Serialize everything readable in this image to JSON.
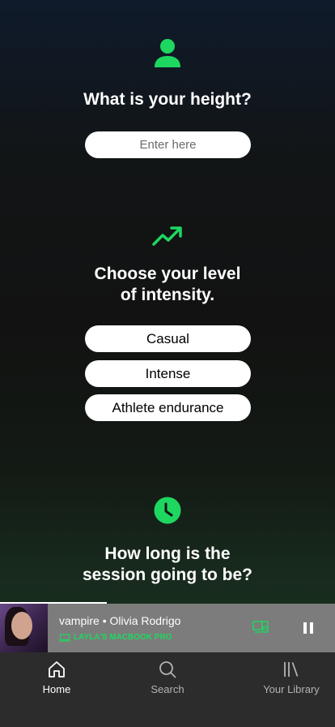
{
  "height_section": {
    "question": "What is your height?",
    "input_placeholder": "Enter here"
  },
  "intensity_section": {
    "question_line1": "Choose your level",
    "question_line2": "of intensity.",
    "options": [
      "Casual",
      "Intense",
      "Athlete endurance"
    ]
  },
  "session_section": {
    "question_line1": "How long is the",
    "question_line2": "session going to be?"
  },
  "player": {
    "song": "vampire",
    "separator": "•",
    "artist": "Olivia Rodrigo",
    "device": "LAYLA'S MACBOOK PRO",
    "progress_fraction": 0.32
  },
  "nav": {
    "home": "Home",
    "search": "Search",
    "library": "Your Library"
  },
  "colors": {
    "accent": "#1ed760",
    "nav_bg": "#2c2c2c",
    "player_bg": "#7c7c7c"
  },
  "icons": {
    "section1": "person-icon",
    "section2": "trending-up-icon",
    "section3": "clock-icon"
  }
}
